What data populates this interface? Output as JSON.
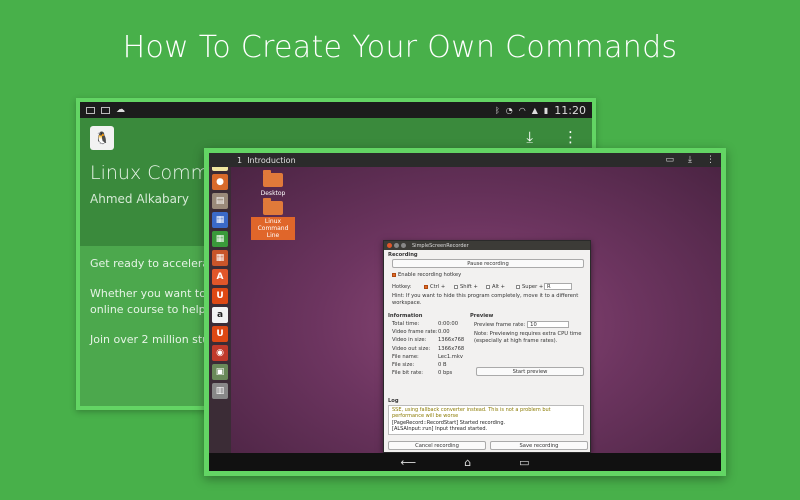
{
  "headline": "How To Create Your Own Commands",
  "colors": {
    "background": "#48b04a",
    "frame": "#63d564",
    "app_header": "#3a8a3c",
    "accent_orange": "#e0662a"
  },
  "back_app": {
    "status_time": "11:20",
    "title": "Linux Comma",
    "author": "Ahmed Alkabary",
    "body": [
      "Get ready to accelerate you",
      "Whether you want to start a",
      "online course to help you ge",
      "Join over 2 million students"
    ],
    "icons": [
      "download-icon",
      "overflow-menu-icon"
    ]
  },
  "tablet": {
    "chapter_number": "1",
    "chapter_title": "Introduction",
    "desktop_items": [
      "Desktop",
      "Linux Command Line"
    ],
    "nav_icons": [
      "back-icon",
      "home-icon",
      "recents-icon"
    ]
  },
  "recorder": {
    "window_title": "SimpleScreenRecorder",
    "recording_heading": "Recording",
    "pause_button": "Pause recording",
    "enable_hotkey": "Enable recording hotkey",
    "hotkey_label": "Hotkey:",
    "ctrl": "Ctrl +",
    "shift": "Shift +",
    "alt": "Alt +",
    "super": "Super +",
    "key": "R",
    "hint": "Hint: If you want to hide this program completely, move it to a different workspace.",
    "information_heading": "Information",
    "info": [
      {
        "k": "Total time:",
        "v": "0:00:00"
      },
      {
        "k": "Video frame rate:",
        "v": "0.00"
      },
      {
        "k": "Video in size:",
        "v": "1366x768"
      },
      {
        "k": "Video out size:",
        "v": "1366x768"
      },
      {
        "k": "File name:",
        "v": "Lec1.mkv"
      },
      {
        "k": "File size:",
        "v": "0 B"
      },
      {
        "k": "File bit rate:",
        "v": "0 bps"
      }
    ],
    "preview_heading": "Preview",
    "preview_rate_label": "Preview frame rate:",
    "preview_rate_value": "10",
    "preview_note": "Note: Previewing requires extra CPU time (especially at high frame rates).",
    "start_preview": "Start preview",
    "log_heading": "Log",
    "log_lines": [
      "SSE, using fallback converter instead. This is not a problem but",
      "performance will be worse",
      "[PageRecord::RecordStart] Started recording.",
      "[ALSAInput::run] Input thread started."
    ],
    "cancel_button": "Cancel recording",
    "save_button": "Save recording"
  }
}
